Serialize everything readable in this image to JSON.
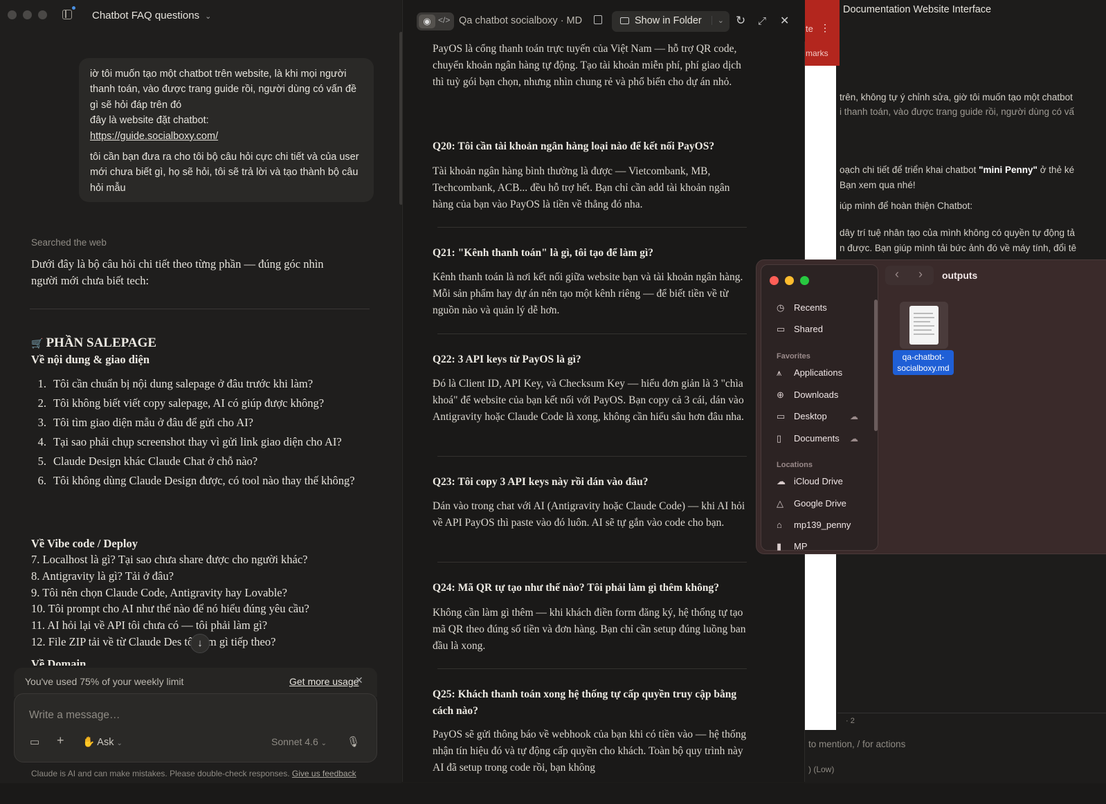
{
  "left": {
    "title": "Chatbot FAQ questions",
    "user_message": {
      "p1": "iờ tôi muốn tạo một chatbot trên website, là khi mọi người thanh toán, vào được trang guide rồi, người dùng có vấn đề gì sẽ hỏi đáp trên đó",
      "p1b": "đây là website đặt chatbot:",
      "link": "https://guide.socialboxy.com/",
      "p2": "tôi cần bạn đưa ra cho tôi bộ câu hỏi cực chi tiết và của user mới chưa biết gì, họ sẽ hỏi, tôi sẽ trả lời và tạo thành bộ câu hỏi mẫu"
    },
    "searched": "Searched the web",
    "intro": "Dưới đây là bộ câu hỏi chi tiết theo từng phần — đúng góc nhìn người mới chưa biết tech:",
    "section_icon": "🛒",
    "section_title": "PHẦN SALEPAGE",
    "sub1": "Về nội dung & giao diện",
    "list1": [
      {
        "n": "1.",
        "t": "Tôi cần chuẩn bị nội dung salepage ở đâu trước khi làm?"
      },
      {
        "n": "2.",
        "t": "Tôi không biết viết copy salepage, AI có giúp được không?"
      },
      {
        "n": "3.",
        "t": "Tôi tìm giao diện mẫu ở đâu để gửi cho AI?"
      },
      {
        "n": "4.",
        "t": "Tại sao phải chụp screenshot thay vì gửi link giao diện cho AI?"
      },
      {
        "n": "5.",
        "t": "Claude Design khác Claude Chat ở chỗ nào?"
      },
      {
        "n": "6.",
        "t": "Tôi không dùng Claude Design được, có tool nào thay thế không?"
      }
    ],
    "sub2": "Về Vibe code / Deploy",
    "list2": [
      "7. Localhost là gì? Tại sao chưa share được cho người khác?",
      "8. Antigravity là gì? Tải ở đâu?",
      "9. Tôi nên chọn Claude Code, Antigravity hay Lovable?",
      "10. Tôi prompt cho AI như thế nào để nó hiểu đúng yêu cầu?",
      "11. AI hỏi lại về API tôi chưa có — tôi phải làm gì?",
      "12. File ZIP tải về từ Claude Des    tôi làm gì tiếp theo?"
    ],
    "sub3": "Về Domain",
    "usage": "You've used 75% of your weekly limit",
    "get_more": "Get more usage",
    "placeholder": "Write a message…",
    "ask": "Ask",
    "model": "Sonnet 4.6",
    "disclaimer": "Claude is AI and can make mistakes. Please double-check responses.",
    "feedback": "Give us feedback"
  },
  "mid": {
    "filename": "Qa chatbot socialboxy · MD",
    "show_in_folder": "Show in Folder",
    "p0": "PayOS là cổng thanh toán trực tuyến của Việt Nam — hỗ trợ QR code, chuyển khoản ngân hàng tự động. Tạo tài khoản miễn phí, phí giao dịch thì tuỳ gói bạn chọn, nhưng nhìn chung rẻ và phổ biến cho dự án nhỏ.",
    "q20": "Q20: Tôi cần tài khoản ngân hàng loại nào để kết nối PayOS?",
    "a20": "Tài khoản ngân hàng bình thường là được — Vietcombank, MB, Techcombank, ACB... đều hỗ trợ hết. Bạn chỉ cần add tài khoản ngân hàng của bạn vào PayOS là tiền về thẳng đó nha.",
    "q21": "Q21: \"Kênh thanh toán\" là gì, tôi tạo để làm gì?",
    "a21": "Kênh thanh toán là nơi kết nối giữa website bạn và tài khoản ngân hàng. Mỗi sản phẩm hay dự án nên tạo một kênh riêng — để biết tiền về từ nguồn nào và quản lý dễ hơn.",
    "q22": "Q22: 3 API keys từ PayOS là gì?",
    "a22": "Đó là Client ID, API Key, và Checksum Key — hiểu đơn giản là 3 \"chìa khoá\" để website của bạn kết nối với PayOS. Bạn copy cả 3 cái, dán vào Antigravity hoặc Claude Code là xong, không cần hiểu sâu hơn đâu nha.",
    "q23": "Q23: Tôi copy 3 API keys này rồi dán vào đâu?",
    "a23": "Dán vào trong chat với AI (Antigravity hoặc Claude Code) — khi AI hỏi về API PayOS thì paste vào đó luôn. AI sẽ tự gắn vào code cho bạn.",
    "q24": "Q24: Mã QR tự tạo như thế nào? Tôi phải làm gì thêm không?",
    "a24": "Không cần làm gì thêm — khi khách điền form đăng ký, hệ thống tự tạo mã QR theo đúng số tiền và đơn hàng. Bạn chỉ cần setup đúng luồng ban đầu là xong.",
    "q25": "Q25: Khách thanh toán xong hệ thống tự cấp quyền truy cập bằng cách nào?",
    "a25": "PayOS sẽ gửi thông báo về webhook của bạn khi có tiền vào — hệ thống nhận tín hiệu đó và tự động cấp quyền cho khách. Toàn bộ quy trình này AI đã setup trong code rồi, bạn không"
  },
  "right": {
    "title": "Documentation Website Interface",
    "red1": "te",
    "red2": "marks",
    "l1": "trên, không tự ý chỉnh sửa, giờ tôi muốn tạo một chatbot",
    "l2": "i thanh toán, vào được trang guide rồi, người dùng có vấ",
    "l3a": "oạch chi tiết để triển khai chatbot ",
    "l3b": "\"mini Penny\"",
    "l3c": " ở thẻ ké",
    "l4": "Bạn xem qua nhé!",
    "l5": "iúp mình để hoàn thiện Chatbot:",
    "l6": "dây trí tuệ nhân tạo của mình không có quyền tự động tả",
    "l7": "n được. Bạn giúp mình tải bức ảnh đó về máy tính, đổi tê",
    "count": "· 2",
    "mention": "to mention, / for actions",
    "low": ") (Low)"
  },
  "finder": {
    "title": "outputs",
    "recents": "Recents",
    "shared": "Shared",
    "favorites": "Favorites",
    "applications": "Applications",
    "downloads": "Downloads",
    "desktop": "Desktop",
    "documents": "Documents",
    "locations": "Locations",
    "icloud": "iCloud Drive",
    "gdrive": "Google Drive",
    "home": "mp139_penny",
    "mp": "MP",
    "file": "qa-chatbot-socialboxy.md"
  }
}
